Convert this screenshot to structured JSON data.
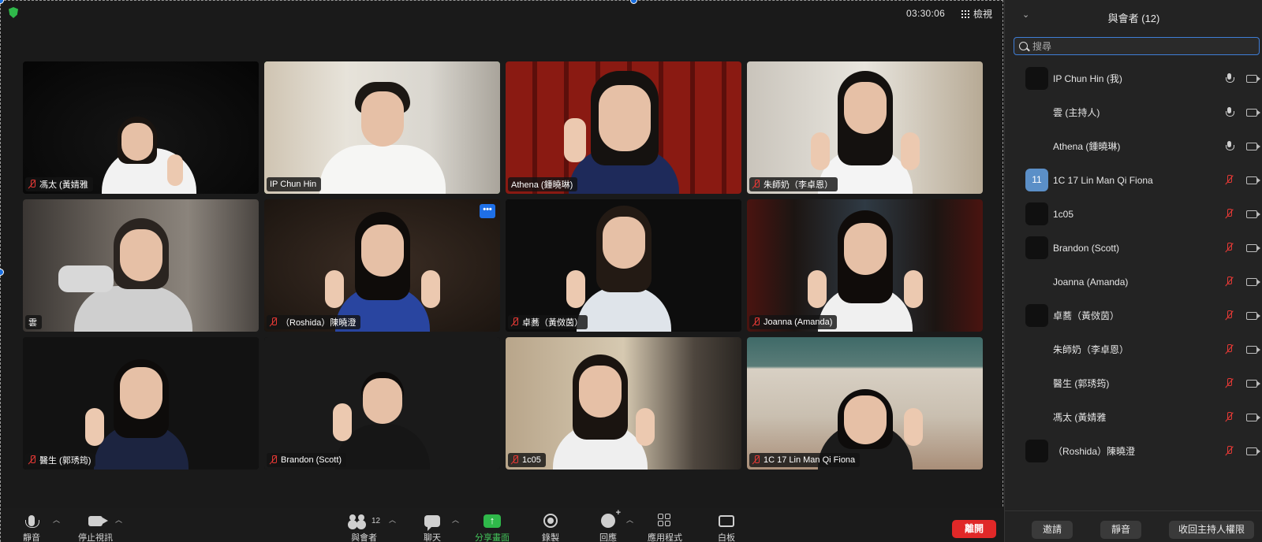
{
  "header": {
    "timer": "03:30:06",
    "view_label": "檢視"
  },
  "tiles": [
    {
      "name": "馮太 (黃婧雅",
      "muted": true
    },
    {
      "name": "IP Chun Hin",
      "muted": false
    },
    {
      "name": "Athena (鍾曉琳)",
      "muted": false
    },
    {
      "name": "朱師奶（李卓恩）",
      "muted": true
    },
    {
      "name": "雲",
      "muted": false
    },
    {
      "name": "（Roshida）陳曉澄",
      "muted": true
    },
    {
      "name": "卓蕎（黃傚茵）",
      "muted": true
    },
    {
      "name": "Joanna (Amanda)",
      "muted": true
    },
    {
      "name": "醫生 (郭琇筠)",
      "muted": true
    },
    {
      "name": "Brandon (Scott)",
      "muted": true
    },
    {
      "name": "1c05",
      "muted": true
    },
    {
      "name": "1C 17 Lin Man Qi Fiona",
      "muted": true
    }
  ],
  "toolbar": {
    "mute": "靜音",
    "stop_video": "停止視訊",
    "participants": "與會者",
    "participants_count": "12",
    "chat": "聊天",
    "share": "分享畫面",
    "record": "錄製",
    "reactions": "回應",
    "apps": "應用程式",
    "whiteboard": "白板",
    "leave": "離開"
  },
  "panel": {
    "title": "與會者 (12)",
    "search_placeholder": "搜尋",
    "participants": [
      {
        "name": "IP Chun Hin (我)",
        "avatar": "dark",
        "mic": "on"
      },
      {
        "name": "雲 (主持人)",
        "avatar": "none",
        "mic": "on"
      },
      {
        "name": "Athena (鍾曉琳)",
        "avatar": "none",
        "mic": "on"
      },
      {
        "name": "1C 17 Lin Man Qi Fiona",
        "avatar": "num",
        "avatar_text": "11",
        "mic": "muted"
      },
      {
        "name": "1c05",
        "avatar": "dark",
        "mic": "muted"
      },
      {
        "name": "Brandon (Scott)",
        "avatar": "dark",
        "mic": "muted"
      },
      {
        "name": "Joanna (Amanda)",
        "avatar": "none",
        "mic": "muted"
      },
      {
        "name": "卓蕎（黃傚茵）",
        "avatar": "dark",
        "mic": "muted"
      },
      {
        "name": "朱師奶（李卓恩）",
        "avatar": "none",
        "mic": "muted"
      },
      {
        "name": "醫生 (郭琇筠)",
        "avatar": "none",
        "mic": "muted"
      },
      {
        "name": "馮太 (黃婧雅",
        "avatar": "none",
        "mic": "muted"
      },
      {
        "name": "（Roshida）陳曉澄",
        "avatar": "dark",
        "mic": "muted"
      }
    ],
    "footer": {
      "invite": "邀請",
      "mute_all": "靜音",
      "reclaim_host": "收回主持人權限"
    }
  },
  "colors": {
    "active_speaker": "#62c554",
    "share_green": "#2fb84a",
    "leave_red": "#e02828",
    "search_focus": "#3f7dd6",
    "muted_red": "#e53935"
  }
}
